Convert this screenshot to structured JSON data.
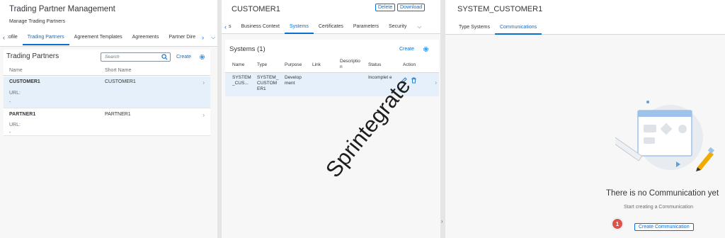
{
  "col1": {
    "title": "Trading Partner Management",
    "subtitle": "Manage Trading Partners",
    "tabs": [
      ":ofile",
      "Trading Partners",
      "Agreement Templates",
      "Agreements",
      "Partner Dire"
    ],
    "panel_title": "Trading Partners",
    "search_placeholder": "Search",
    "create_label": "Create",
    "col_name": "Name",
    "col_short": "Short Name",
    "rows": [
      {
        "name": "CUSTOMER1",
        "short": "CUSTOMER1",
        "url_label": "URL:",
        "url_value": "-"
      },
      {
        "name": "PARTNER1",
        "short": "PARTNER1",
        "url_label": "URL:",
        "url_value": "-"
      }
    ]
  },
  "col2": {
    "title": "CUSTOMER1",
    "delete_label": "Delete",
    "download_label": "Download",
    "tabs": [
      "s",
      "Business Context",
      "Systems",
      "Certificates",
      "Parameters",
      "Security"
    ],
    "panel_title": "Systems (1)",
    "create_label": "Create",
    "headers": [
      "Name",
      "Type",
      "Purpose",
      "Link",
      "Descriptio n",
      "Status",
      "Action"
    ],
    "row": {
      "name": "SYSTEM _CUS...",
      "type": "SYSTEM_ CUSTOM ER1",
      "purpose": "Develop ment",
      "link": "",
      "description": "",
      "status": "Incomplet e"
    }
  },
  "col3": {
    "title": "SYSTEM_CUSTOMER1",
    "tabs": [
      "Type Systems",
      "Communications"
    ],
    "empty_title": "There is no Communication yet",
    "empty_sub": "Start creating a Communication",
    "create_label": "Create Communication",
    "step_badge": "1"
  },
  "watermark": "Sprintegrate"
}
